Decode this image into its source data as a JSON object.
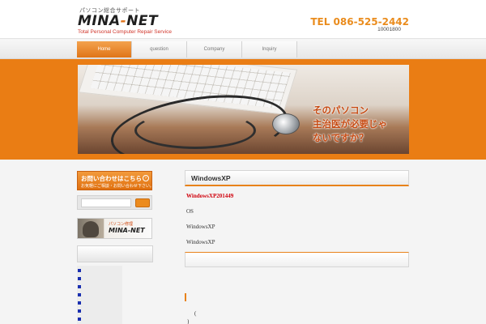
{
  "header": {
    "tagline": "パソコン総合サポート",
    "logo_text_a": "MINA",
    "logo_text_dash": "-",
    "logo_text_b": "NET",
    "logo_sub": "Total Personal Computer Repair Service",
    "tel": "TEL 086-525-2442",
    "tel_sub": "10001800"
  },
  "nav": {
    "items": [
      {
        "label": "Home",
        "active": true
      },
      {
        "label": "question",
        "active": false
      },
      {
        "label": "Company",
        "active": false
      },
      {
        "label": "Inquiry",
        "active": false
      }
    ]
  },
  "hero": {
    "caption_lines": [
      "そのパソコン",
      "主治医が必要じゃ",
      "ないですか？"
    ]
  },
  "sidebar": {
    "contact_title": "お問い合わせはこちら",
    "contact_sub": "お気軽にご相談・お問い合わせ下さい。",
    "search_placeholder": "",
    "search_button": "",
    "banner_text": "パソコン修理",
    "banner_brand": "MINA-NET"
  },
  "main": {
    "heading": "WindowsXP",
    "red_line": "WindowsXP201449",
    "lines": [
      "OS",
      "WindowsXP",
      "WindowsXP"
    ],
    "glyph_1": "(",
    "glyph_2": ")"
  },
  "colors": {
    "accent": "#ea7d14",
    "tel": "#ea8c1d",
    "red_text": "#d0000b"
  }
}
